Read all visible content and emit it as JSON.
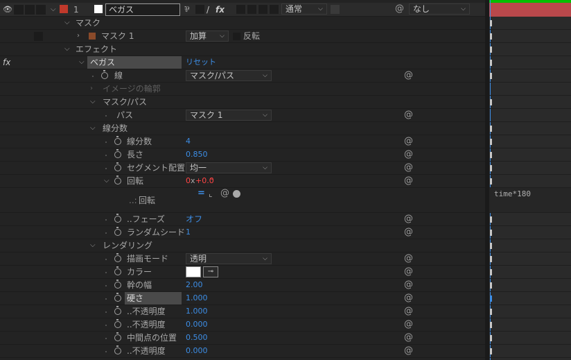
{
  "header": {
    "layer_number": "1",
    "layer_name": "ベガス",
    "mode": "通常",
    "trkmat": "なし",
    "switches": [
      "⅌",
      "/",
      "fx"
    ]
  },
  "mask_group": {
    "label": "マスク"
  },
  "mask": {
    "name": "マスク 1",
    "mode": "加算",
    "invert_label": "反転"
  },
  "effects_group": {
    "label": "エフェクト"
  },
  "fx_badge": "fx",
  "effect": {
    "name": "ベガス",
    "reset": "リセット"
  },
  "props": {
    "stroke": {
      "label": "線",
      "value": "マスク/パス"
    },
    "image_contours": {
      "label": "イメージの輪郭"
    },
    "mask_path_group": {
      "label": "マスク/パス"
    },
    "path": {
      "label": "パス",
      "value": "マスク 1"
    },
    "segments_group": {
      "label": "線分数"
    },
    "segments": {
      "label": "線分数",
      "value": "4"
    },
    "length": {
      "label": "長さ",
      "value": "0.850"
    },
    "segment_distribution": {
      "label": "セグメント配置",
      "value": "均一"
    },
    "rotation": {
      "label": "回転",
      "value_turns": "0",
      "value_x": "x",
      "value_deg": "+0.0",
      "value_unit": "°"
    },
    "rotation_expr": {
      "label": "回転",
      "prefix": "..:",
      "expression": "time*180"
    },
    "phase": {
      "label": "..フェーズ",
      "value": "オフ"
    },
    "random_seed": {
      "label": "ランダムシード",
      "value": "1"
    },
    "rendering_group": {
      "label": "レンダリング"
    },
    "blend_mode": {
      "label": "描画モード",
      "value": "透明"
    },
    "color": {
      "label": "カラー",
      "swatch": "#ffffff"
    },
    "width": {
      "label": "幹の幅",
      "value": "2.00"
    },
    "hardness": {
      "label": "硬さ",
      "value": "1.000"
    },
    "start_opacity": {
      "label": "..不透明度",
      "value": "1.000"
    },
    "end_opacity": {
      "label": "..不透明度",
      "value": "0.000"
    },
    "midpoint_position": {
      "label": "中間点の位置",
      "value": "0.500"
    },
    "mid_opacity": {
      "label": "..不透明度",
      "value": "0.000"
    }
  },
  "colors": {
    "label_color": "#c0392b",
    "mask_color": "#8a4a2a",
    "accent_blue": "#3d8ee6",
    "keyframe_red": "#ff4545",
    "layer_bar": "#b9484b",
    "timeline_green": "#00c000"
  }
}
